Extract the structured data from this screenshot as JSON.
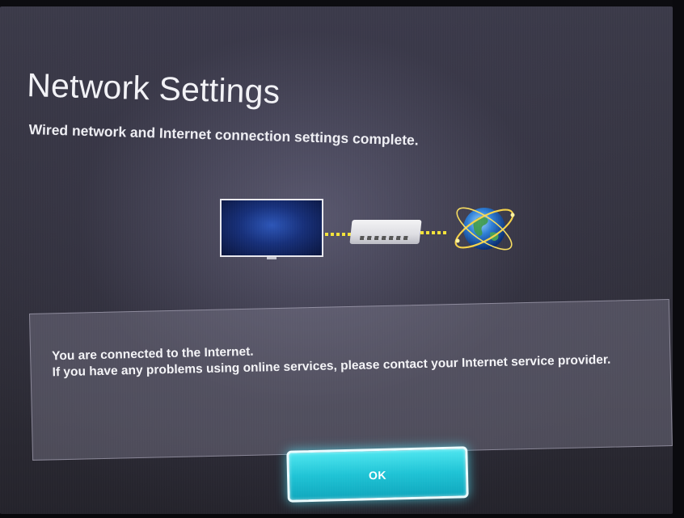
{
  "header": {
    "title": "Network Settings",
    "subtitle": "Wired network and Internet connection settings complete."
  },
  "diagram": {
    "icons": [
      "tv-icon",
      "router-icon",
      "globe-icon"
    ],
    "link_color": "#f3e23a"
  },
  "message": {
    "line1": "You are connected to the Internet.",
    "line2": "If you have any problems using online services, please contact your Internet service provider."
  },
  "buttons": {
    "ok_label": "OK"
  },
  "colors": {
    "accent": "#1fc3d5",
    "background": "#34333f"
  }
}
